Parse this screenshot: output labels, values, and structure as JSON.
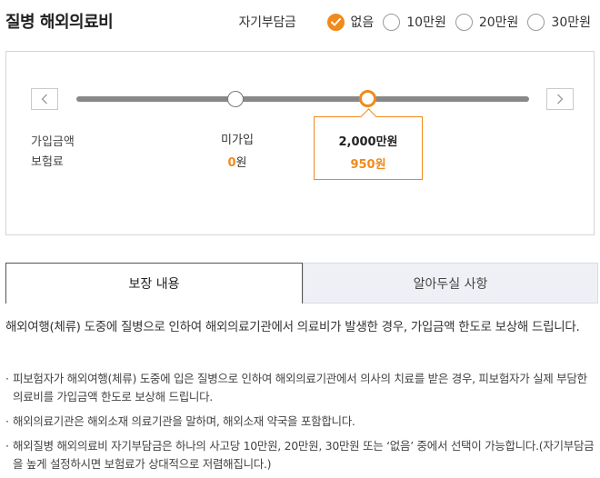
{
  "title": "질병 해외의료비",
  "deductible": {
    "label": "자기부담금",
    "options": [
      {
        "label": "없음",
        "checked": true
      },
      {
        "label": "10만원",
        "checked": false
      },
      {
        "label": "20만원",
        "checked": false
      },
      {
        "label": "30만원",
        "checked": false
      }
    ]
  },
  "panel": {
    "row_labels": {
      "amount": "가입금액",
      "premium": "보험료"
    },
    "plans": [
      {
        "amount": "미가입",
        "premium_num": "0",
        "premium_unit": "원",
        "selected": false
      },
      {
        "amount": "2,000만원",
        "premium": "950원",
        "selected": true
      }
    ],
    "slider_selected_index": 1
  },
  "tabs": [
    {
      "label": "보장 내용",
      "active": true
    },
    {
      "label": "알아두실 사항",
      "active": false
    }
  ],
  "content": {
    "description": "해외여행(체류) 도중에 질병으로 인하여 해외의료기관에서 의료비가 발생한 경우, 가입금액 한도로 보상해 드립니다.",
    "bullets": [
      "피보험자가 해외여행(체류) 도중에 입은 질병으로 인하여 해외의료기관에서 의사의 치료를 받은 경우, 피보험자가 실제 부담한 의료비를 가입금액 한도로 보상해 드립니다.",
      "해외의료기관은 해외소재 의료기관을 말하며, 해외소재 약국을 포함합니다.",
      "해외질병 해외의료비 자기부담금은 하나의 사고당 10만원, 20만원, 30만원 또는 ‘없음’ 중에서 선택이 가능합니다.(자기부담금을 높게 설정하시면 보험료가 상대적으로 저렴해집니다.)"
    ],
    "bullet_marker": "·"
  },
  "colors": {
    "accent": "#f08a1c",
    "tab_inactive_bg": "#eef0f5"
  }
}
